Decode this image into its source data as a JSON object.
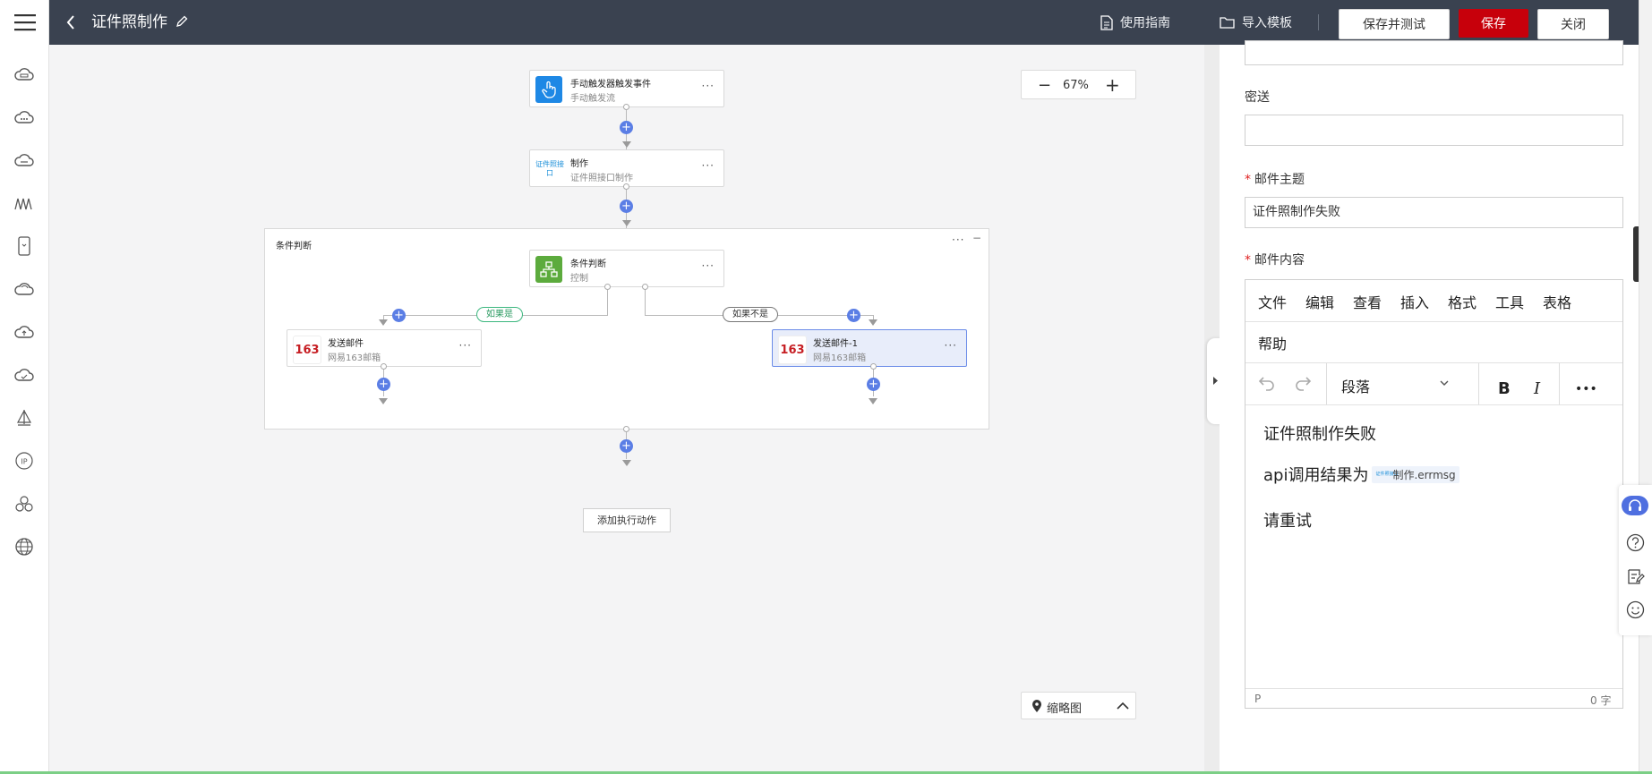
{
  "header": {
    "title": "证件照制作",
    "guide_label": "使用指南",
    "import_label": "导入模板",
    "save_test_label": "保存并测试",
    "save_label": "保存",
    "close_label": "关闭"
  },
  "canvas": {
    "zoom": "67%",
    "minimap_label": "缩略图",
    "add_action_label": "添加执行动作",
    "group_title": "条件判断",
    "branch_true_label": "如果是",
    "branch_false_label": "如果不是",
    "nodes": {
      "trigger": {
        "title": "手动触发器触发事件",
        "subtitle": "手动触发流"
      },
      "make": {
        "title": "制作",
        "subtitle": "证件照接口制作",
        "icon_text": "证件照接口"
      },
      "condition": {
        "title": "条件判断",
        "subtitle": "控制"
      },
      "mail_left": {
        "title": "发送邮件",
        "subtitle": "网易163邮箱",
        "icon_text": "163"
      },
      "mail_right": {
        "title": "发送邮件-1",
        "subtitle": "网易163邮箱",
        "icon_text": "163"
      }
    }
  },
  "panel": {
    "cc_label": "密送",
    "subject_label": "邮件主题",
    "subject_value": "证件照制作失败",
    "content_label": "邮件内容",
    "menu": [
      "文件",
      "编辑",
      "查看",
      "插入",
      "格式",
      "工具",
      "表格",
      "帮助"
    ],
    "toolbar": {
      "block_format": "段落",
      "bold": "B",
      "italic": "I",
      "more": "•••"
    },
    "body": {
      "line1": "证件照制作失败",
      "line2_prefix": "api调用结果为",
      "token_label": "制作.errmsg",
      "token_icon_text": "证件照接口",
      "line3": "请重试"
    },
    "status": {
      "path": "P",
      "word_count": "0 字"
    }
  },
  "colors": {
    "header_bg": "#3a4250",
    "primary_red": "#c7000b",
    "plus_blue": "#5b7ee5",
    "trigger_blue": "#1e88e5",
    "condition_green": "#5cab3d",
    "selected_bg": "#e8edfa"
  }
}
